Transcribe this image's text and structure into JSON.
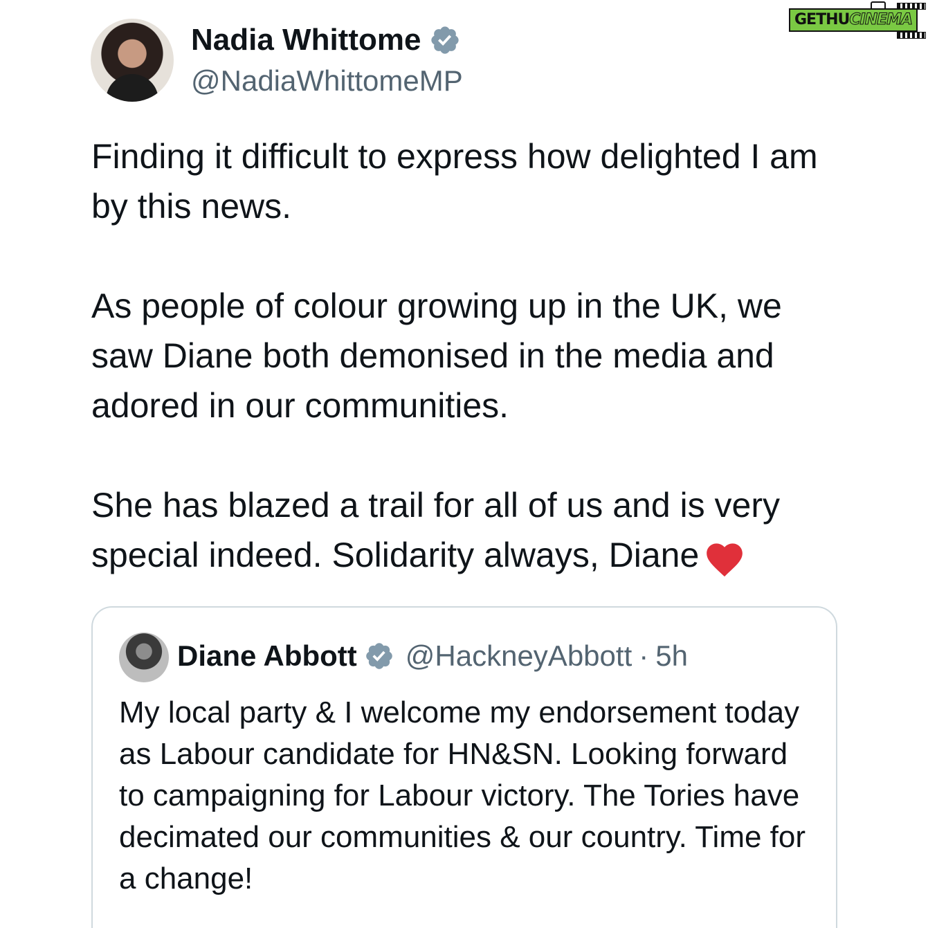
{
  "watermark": {
    "left_text": "GETHU",
    "right_text": "CINEMA"
  },
  "tweet": {
    "author": {
      "display_name": "Nadia Whittome",
      "handle": "@NadiaWhittomeMP",
      "verified_icon": "verified-badge-icon"
    },
    "paragraphs": [
      "Finding it difficult to express how delighted I am by this news.",
      "As people of colour growing up in the UK, we saw Diane both demonised in the media and adored in our communities.",
      "She has blazed a trail for all of us and is very special indeed. Solidarity always, Diane"
    ],
    "emoji": "heart-icon"
  },
  "quoted_tweet": {
    "display_name": "Diane Abbott",
    "handle": "@HackneyAbbott",
    "separator": "·",
    "time": "5h",
    "text": "My local party & I welcome my endorsement today as Labour candidate for HN&SN. Looking forward to campaigning for Labour victory. The Tories have decimated our communities & our country. Time for a change!"
  },
  "colors": {
    "text_primary": "#0f1419",
    "text_secondary": "#536471",
    "verified_badge": "#829aab",
    "heart": "#e0303a",
    "border": "#cfd9de",
    "watermark_green": "#7ac943"
  }
}
